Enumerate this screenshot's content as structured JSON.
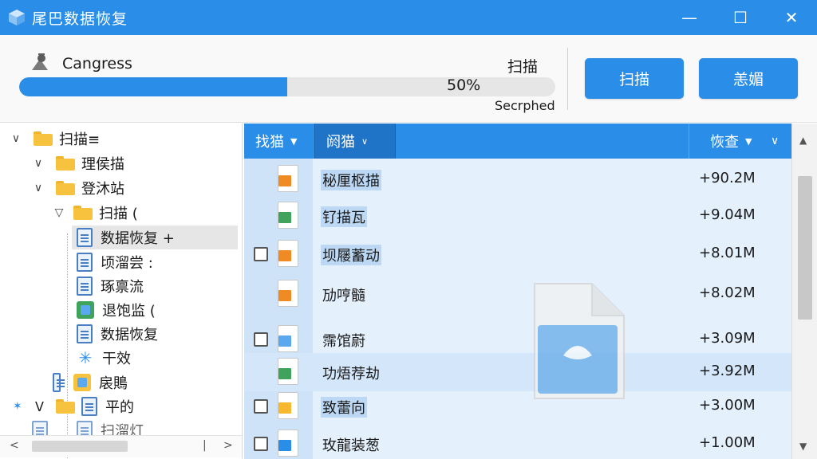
{
  "window": {
    "title": "尾巴数据恢复",
    "minimize_glyph": "—",
    "maximize_glyph": "☐",
    "close_glyph": "✕"
  },
  "header": {
    "status_label": "Cangress",
    "scan_small_label": "扫描",
    "progress_percent": 50,
    "progress_text": "50%",
    "sub_status": "Secrphed",
    "scan_button": "扫描",
    "recover_button": "恙媚"
  },
  "tree": {
    "items": [
      {
        "label": "扫描≡",
        "icon": "folder-icon",
        "chevron": "∨"
      },
      {
        "label": "理侯描",
        "icon": "folder-icon",
        "chevron": "∨"
      },
      {
        "label": "登沐站",
        "icon": "folder-icon",
        "chevron": "∨"
      },
      {
        "label": "扫描 (",
        "icon": "folder-icon",
        "chevron": "▽"
      },
      {
        "label": "数据恢复 +",
        "icon": "document-icon",
        "selected": true
      },
      {
        "label": "顷溜尝 :",
        "icon": "document-icon"
      },
      {
        "label": "琢禀流",
        "icon": "document-icon"
      },
      {
        "label": "退饱监 (",
        "icon": "image-icon"
      },
      {
        "label": "数据恢复",
        "icon": "document-icon"
      },
      {
        "label": "干效",
        "icon": "star-icon"
      },
      {
        "label": "扆鵙",
        "icon": "image-icon"
      },
      {
        "label": "平的",
        "icon": "document-icon"
      },
      {
        "label": "扫溜灯",
        "icon": "document-icon"
      }
    ]
  },
  "list": {
    "columns": [
      {
        "label": "找猫"
      },
      {
        "label": "阏猫"
      },
      {
        "label": "恢查"
      }
    ],
    "rows": [
      {
        "name": "秘厘枢描",
        "size": "+90.2M",
        "badge_color": "#f08a24",
        "checkbox": false
      },
      {
        "name": "钌描瓦",
        "size": "+9.04M",
        "badge_color": "#3fa35b",
        "checkbox": false
      },
      {
        "name": "坝屦蓄动",
        "size": "+8.01M",
        "badge_color": "#f08a24",
        "checkbox": true
      },
      {
        "name": "劢哼髓",
        "size": "+8.02M",
        "badge_color": "#f08a24",
        "checkbox": false
      },
      {
        "name": "霈馆蔚",
        "size": "+3.09M",
        "badge_color": "#5aa8f0",
        "checkbox": true
      },
      {
        "name": "功焐荐劫",
        "size": "+3.92M",
        "badge_color": "#3fa35b",
        "checkbox": false,
        "highlight": true
      },
      {
        "name": "致蕾向",
        "size": "+3.00M",
        "badge_color": "#f5b82e",
        "checkbox": true
      },
      {
        "name": "玫龍装葱",
        "size": "+1.00M",
        "badge_color": "#2a8ee8",
        "checkbox": true
      }
    ]
  },
  "colors": {
    "accent": "#2a8ee8",
    "list_bg": "#e4f0fc"
  }
}
